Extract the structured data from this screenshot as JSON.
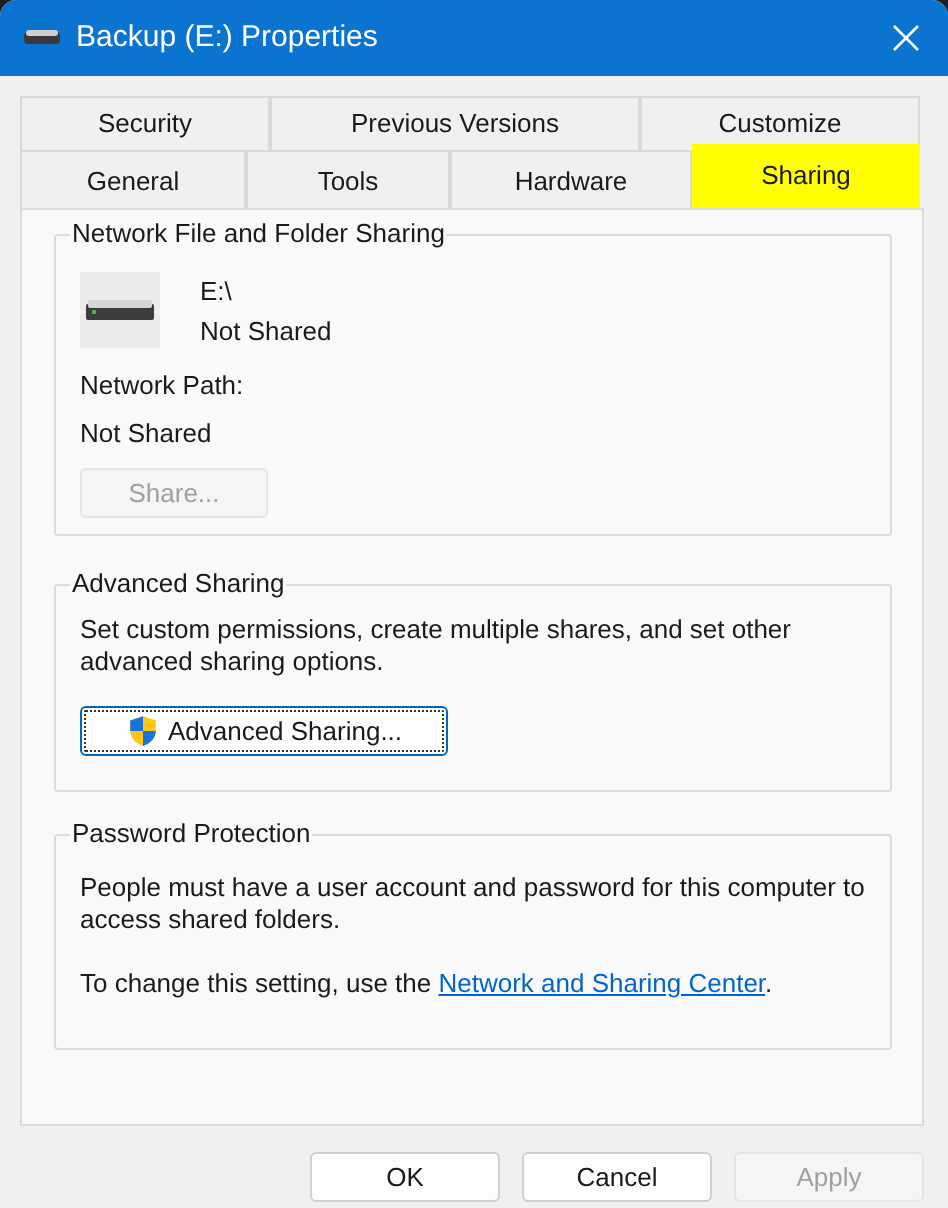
{
  "window": {
    "title": "Backup (E:) Properties"
  },
  "tab_rows": [
    [
      {
        "label": "Security",
        "selected": false
      },
      {
        "label": "Previous Versions",
        "selected": false
      },
      {
        "label": "Customize",
        "selected": false
      }
    ],
    [
      {
        "label": "General",
        "selected": false
      },
      {
        "label": "Tools",
        "selected": false
      },
      {
        "label": "Hardware",
        "selected": false
      },
      {
        "label": "Sharing",
        "selected": true
      }
    ]
  ],
  "network_sharing": {
    "title": "Network File and Folder Sharing",
    "drive": "E:\\",
    "status": "Not Shared",
    "path_label": "Network Path:",
    "path": "Not Shared",
    "share_button": {
      "label": "Share...",
      "disabled": true
    }
  },
  "advanced_sharing": {
    "title": "Advanced Sharing",
    "text": "Set custom permissions, create multiple shares, and set other advanced sharing options.",
    "button": {
      "label": "Advanced Sharing...",
      "disabled": false,
      "focused": true
    }
  },
  "password_protection": {
    "title": "Password Protection",
    "text": "People must have a user account and password for this computer to access shared folders.",
    "change_text": "To change this setting, use the ",
    "link": "Network and Sharing Center",
    "after_link": "."
  },
  "buttons": [
    {
      "label": "OK",
      "disabled": false
    },
    {
      "label": "Cancel",
      "disabled": false
    },
    {
      "label": "Apply",
      "disabled": true
    }
  ]
}
